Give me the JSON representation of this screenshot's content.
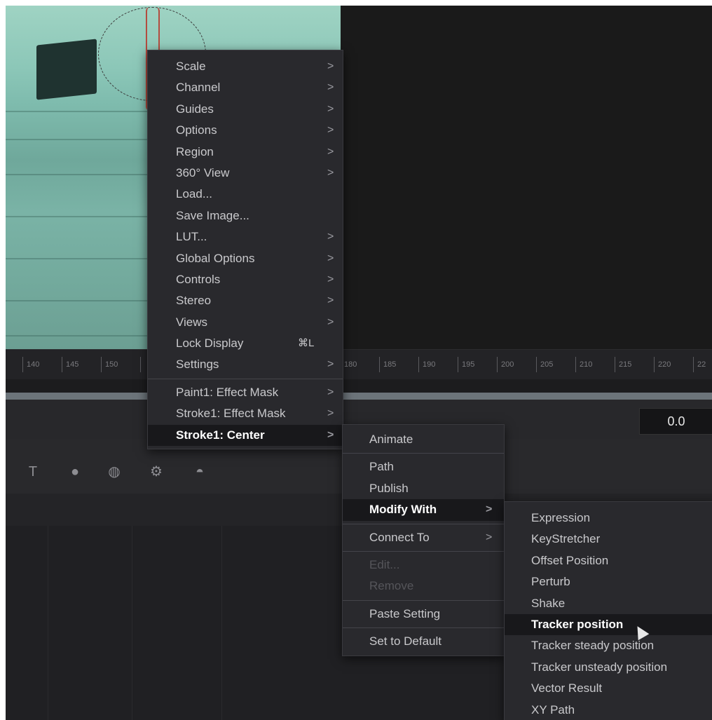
{
  "ruler": {
    "ticks": [
      "140",
      "145",
      "150",
      "",
      "180",
      "185",
      "190",
      "195",
      "200",
      "205",
      "210",
      "215",
      "220",
      "22"
    ]
  },
  "value_box": "0.0",
  "tools": [
    "text-tool-icon",
    "paint-tool-icon",
    "mask-tool-icon",
    "particle-tool-icon",
    "shape3d-tool-icon"
  ],
  "menu_main": {
    "items": [
      {
        "label": "Scale",
        "arrow": true
      },
      {
        "label": "Channel",
        "arrow": true
      },
      {
        "label": "Guides",
        "arrow": true
      },
      {
        "label": "Options",
        "arrow": true
      },
      {
        "label": "Region",
        "arrow": true
      },
      {
        "label": "360° View",
        "arrow": true
      },
      {
        "label": "Load...",
        "arrow": false
      },
      {
        "label": "Save Image...",
        "arrow": false
      },
      {
        "label": "LUT...",
        "arrow": true
      },
      {
        "label": "Global Options",
        "arrow": true
      },
      {
        "label": "Controls",
        "arrow": true
      },
      {
        "label": "Stereo",
        "arrow": true
      },
      {
        "label": "Views",
        "arrow": true
      },
      {
        "label": "Lock Display",
        "shortcut": "⌘L"
      },
      {
        "label": "Settings",
        "arrow": true
      },
      {
        "label": "Paint1: Effect Mask",
        "arrow": true
      },
      {
        "label": "Stroke1: Effect Mask",
        "arrow": true
      },
      {
        "label": "Stroke1: Center",
        "arrow": true,
        "highlighted": true
      }
    ]
  },
  "menu_sub": {
    "items": [
      {
        "label": "Animate"
      },
      {
        "label": "Path"
      },
      {
        "label": "Publish"
      },
      {
        "label": "Modify With",
        "arrow": true,
        "highlighted": true
      },
      {
        "label": "Connect To",
        "arrow": true
      },
      {
        "label": "Edit...",
        "disabled": true
      },
      {
        "label": "Remove",
        "disabled": true
      },
      {
        "label": "Paste Setting"
      },
      {
        "label": "Set to Default"
      }
    ],
    "arrow_glyph": ">"
  },
  "menu_sub2": {
    "items": [
      {
        "label": "Expression"
      },
      {
        "label": "KeyStretcher"
      },
      {
        "label": "Offset Position"
      },
      {
        "label": "Perturb"
      },
      {
        "label": "Shake"
      },
      {
        "label": "Tracker position",
        "highlighted": true
      },
      {
        "label": "Tracker steady position"
      },
      {
        "label": "Tracker unsteady position"
      },
      {
        "label": "Vector Result"
      },
      {
        "label": "XY Path"
      }
    ]
  }
}
